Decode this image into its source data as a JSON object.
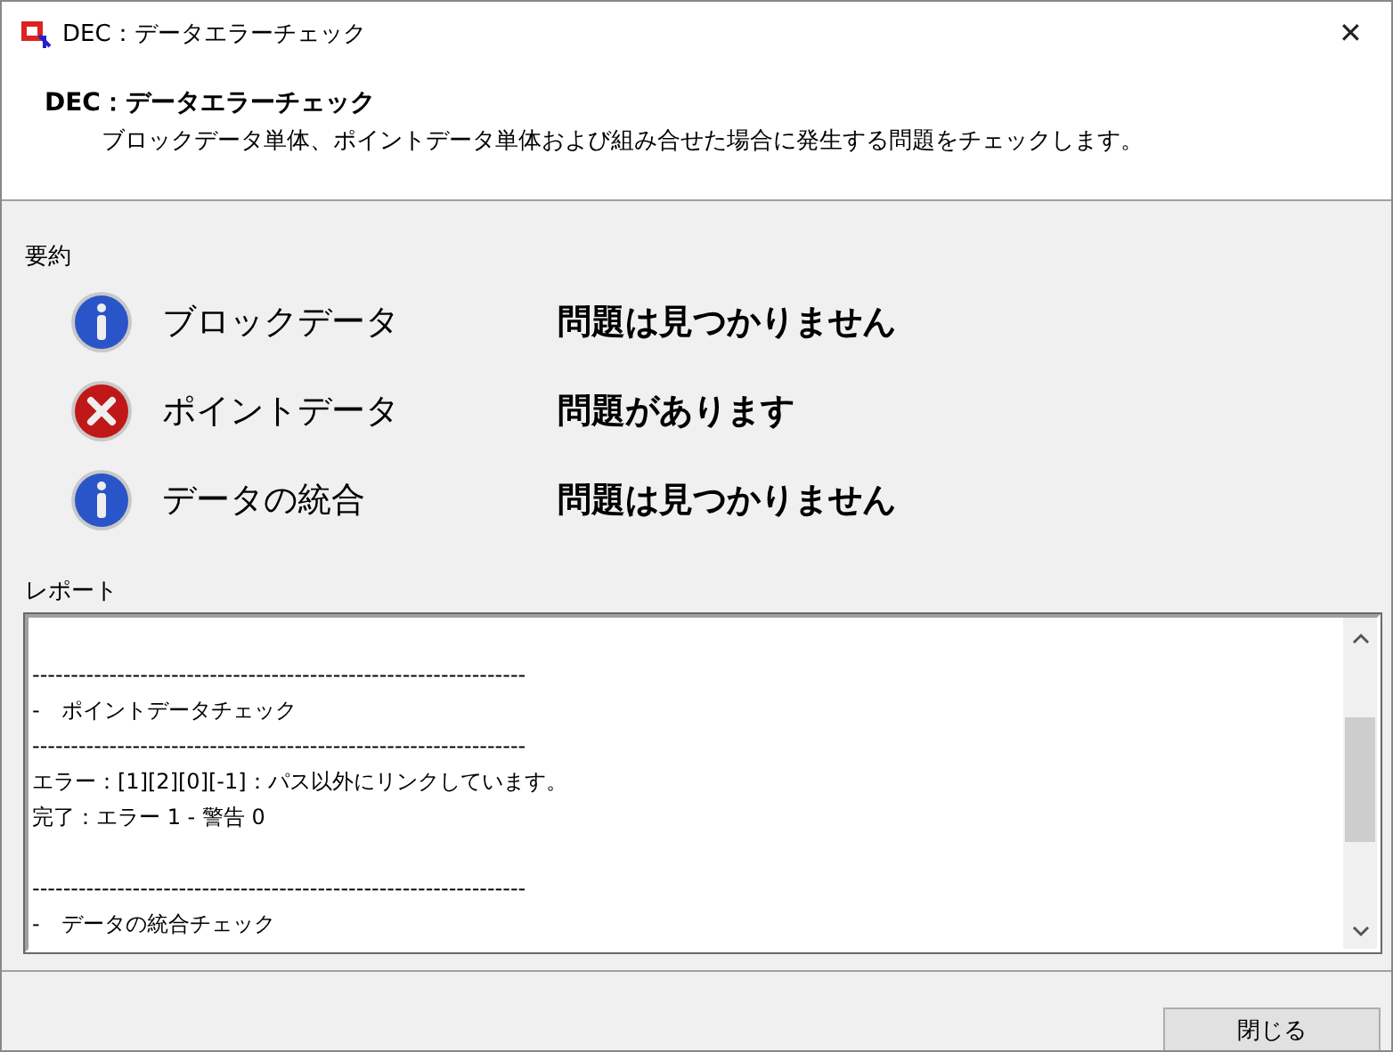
{
  "window": {
    "title": "DEC：データエラーチェック",
    "close": "✕"
  },
  "header": {
    "title": "DEC：データエラーチェック",
    "description": "ブロックデータ単体、ポイントデータ単体および組み合せた場合に発生する問題をチェックします。"
  },
  "summary": {
    "label": "要約",
    "items": [
      {
        "kind": "info",
        "name": "ブロックデータ",
        "status": "問題は見つかりません"
      },
      {
        "kind": "error",
        "name": "ポイントデータ",
        "status": "問題があります"
      },
      {
        "kind": "info",
        "name": "データの統合",
        "status": "問題は見つかりません"
      }
    ]
  },
  "report": {
    "label": "レポート",
    "blocks": [
      {
        "lines": [
          "----------------------------------------------------------------",
          "-　ポイントデータチェック",
          "----------------------------------------------------------------",
          "エラー：[1][2][0][-1]：パス以外にリンクしています。",
          "完了：エラー 1 - 警告 0"
        ]
      },
      {
        "lines": [
          "----------------------------------------------------------------",
          "-　データの統合チェック"
        ]
      }
    ]
  },
  "buttons": [
    {
      "label": "閉じる"
    }
  ]
}
